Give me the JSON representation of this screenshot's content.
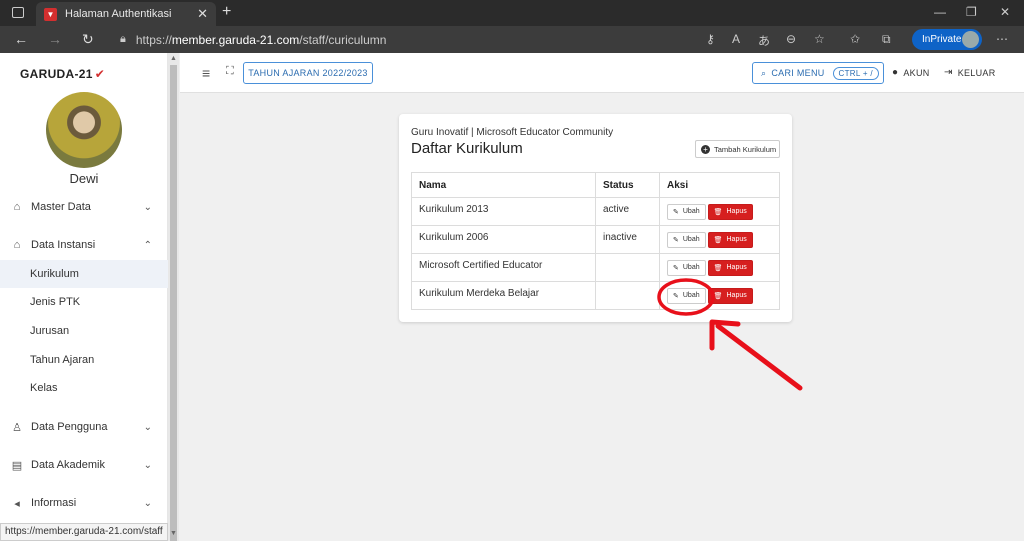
{
  "browser": {
    "tab_title": "Halaman Authentikasi",
    "url_prefix": "https://",
    "url_domain": "member.garuda-21.com",
    "url_path": "/staff/curiculumn",
    "inprivate_label": "InPrivate",
    "status_url": "https://member.garuda-21.com/staff"
  },
  "sidebar": {
    "brand": "GARUDA-21",
    "username": "Dewi",
    "menu": {
      "master_data": "Master Data",
      "data_instansi": "Data Instansi",
      "data_pengguna": "Data Pengguna",
      "data_akademik": "Data Akademik",
      "informasi": "Informasi"
    },
    "submenu": {
      "kurikulum": "Kurikulum",
      "jenis_ptk": "Jenis PTK",
      "jurusan": "Jurusan",
      "tahun_ajaran": "Tahun Ajaran",
      "kelas": "Kelas"
    }
  },
  "header": {
    "year_button": "TAHUN AJARAN 2022/2023",
    "search_button": "CARI MENU",
    "search_shortcut": "CTRL + /",
    "account_label": "AKUN",
    "logout_label": "KELUAR"
  },
  "card": {
    "subtitle": "Guru Inovatif | Microsoft Educator Community",
    "title": "Daftar Kurikulum",
    "add_button": "Tambah Kurikulum",
    "columns": {
      "nama": "Nama",
      "status": "Status",
      "aksi": "Aksi"
    },
    "edit_label": "Ubah",
    "delete_label": "Hapus",
    "rows": [
      {
        "nama": "Kurikulum 2013",
        "status": "active"
      },
      {
        "nama": "Kurikulum 2006",
        "status": "inactive"
      },
      {
        "nama": "Microsoft Certified Educator",
        "status": ""
      },
      {
        "nama": "Kurikulum Merdeka Belajar",
        "status": ""
      }
    ]
  },
  "colors": {
    "accent": "#2b6cb0",
    "danger": "#d61f1f",
    "annotation": "#e8101a"
  }
}
